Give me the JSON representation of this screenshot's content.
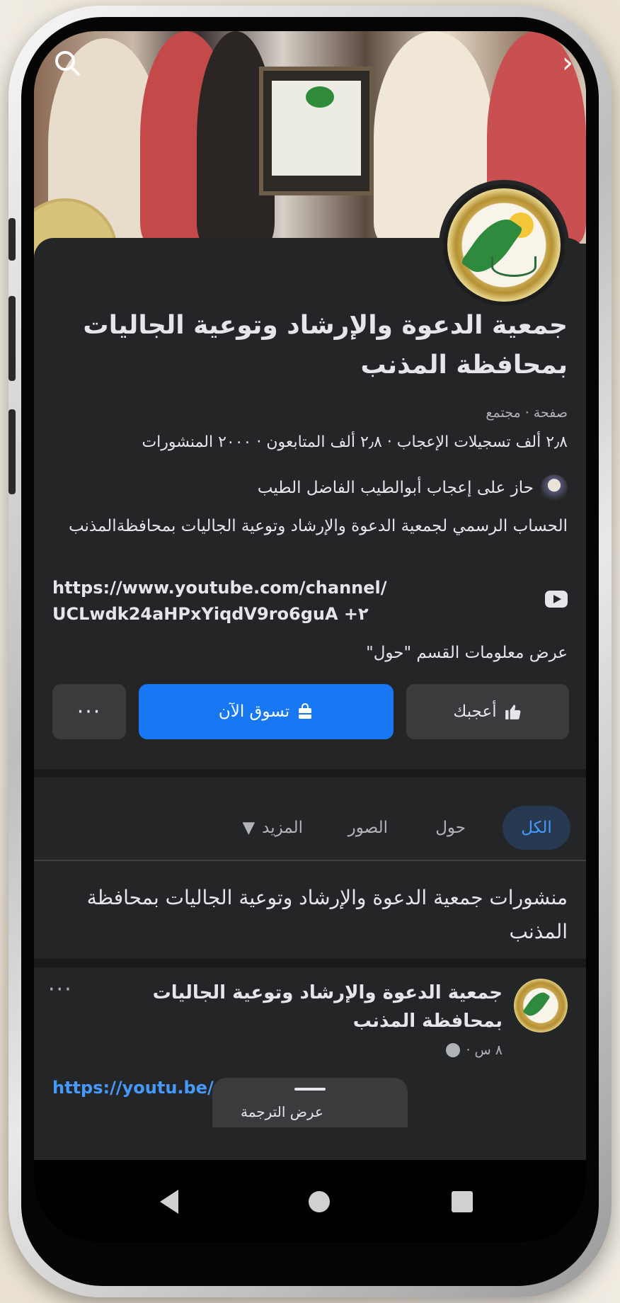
{
  "page": {
    "title": "جمعية الدعوة والإرشاد وتوعية الجاليات بمحافظة المذنب",
    "category": "صفحة · مجتمع",
    "stats": "٢٫٨ ألف تسجيلات الإعجاب · ٢٫٨ ألف المتابعون · ٢٠٠٠ المنشورات",
    "liked_by": "حاز على إعجاب أبوالطيب الفاضل الطيب",
    "bio": "الحساب الرسمي لجمعية الدعوة والإرشاد وتوعية الجاليات بمحافظةالمذنب",
    "link_line1": "https://www.youtube.com/channel/",
    "link_line2": "UCLwdk24aHPxYiqdV9ro6guA +٢",
    "about_link": "عرض معلومات القسم \"حول\""
  },
  "actions": {
    "like_label": "أعجبك",
    "shop_label": "تسوق الآن",
    "more_label": "···"
  },
  "tabs": {
    "all": "الكل",
    "about": "حول",
    "photos": "الصور",
    "more": "المزيد"
  },
  "section": {
    "title": "منشورات جمعية الدعوة والإرشاد وتوعية الجاليات بمحافظة المذنب"
  },
  "post": {
    "author": "جمعية الدعوة والإرشاد وتوعية الجاليات بمحافظة المذنب",
    "time": "٨ س ·",
    "link_text": "https://youtu.be/",
    "more_label": "···"
  },
  "toast": {
    "text": "عرض الترجمة"
  },
  "icons": {
    "search": "search-icon",
    "forward": "chevron-right-icon",
    "youtube": "youtube-icon",
    "like": "thumbs-up-icon",
    "shop": "shopping-bag-icon",
    "globe": "globe-icon"
  },
  "colors": {
    "background": "#242526",
    "primary_button": "#1877f2",
    "link": "#4599ff",
    "active_tab_bg": "#263951"
  }
}
